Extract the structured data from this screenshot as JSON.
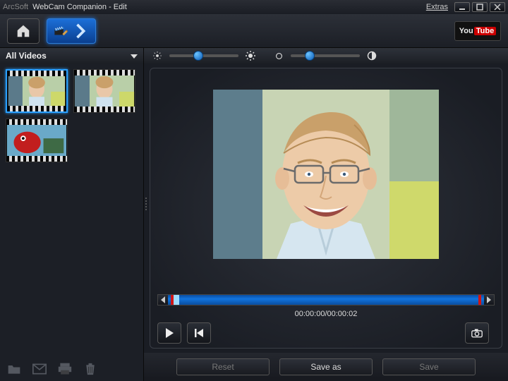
{
  "titlebar": {
    "brand": "ArcSoft",
    "title": "WebCam Companion - Edit",
    "extras_label": "Extras"
  },
  "toolbar": {
    "home_icon": "home-icon",
    "mode_icon": "clapper-edit-icon",
    "youtube": {
      "you": "You",
      "tube": "Tube"
    }
  },
  "sidebar": {
    "filter_label": "All Videos",
    "thumbs": [
      {
        "selected": true,
        "kind": "portrait"
      },
      {
        "selected": false,
        "kind": "portrait"
      },
      {
        "selected": false,
        "kind": "red-scene"
      }
    ]
  },
  "adjust": {
    "brightness": {
      "min_icon": "sun-small",
      "max_icon": "sun-large",
      "value_pct": 42
    },
    "contrast": {
      "min_icon": "circle-outline",
      "max_icon": "half-circle",
      "value_pct": 28
    }
  },
  "timeline": {
    "timecode": "00:00:00/00:00:02",
    "playhead_pct": 2
  },
  "yt": {
    "you": "You",
    "tube": "Tube"
  },
  "buttons": {
    "reset": "Reset",
    "saveas": "Save as",
    "save": "Save"
  },
  "colors": {
    "accent_blue": "#1c6fd8",
    "track_blue": "#1174df",
    "marker_red": "#d01515"
  }
}
